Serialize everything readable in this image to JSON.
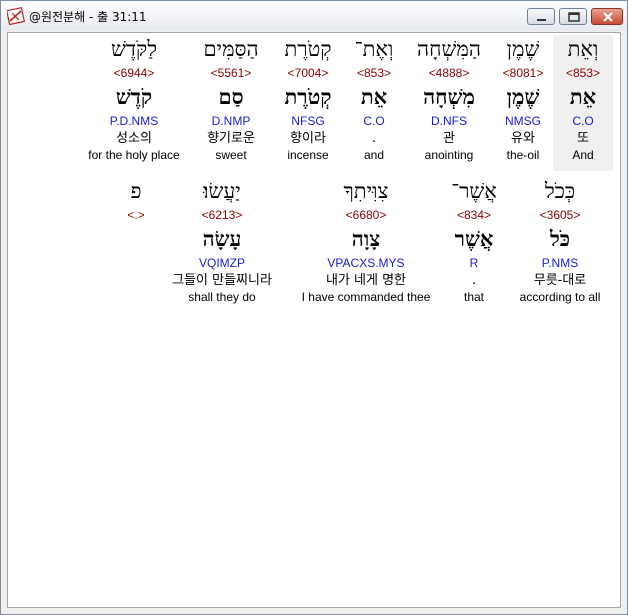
{
  "window": {
    "title": "@원전분해 - 출 31:11"
  },
  "rows": [
    [
      {
        "heb": "וְאֵת",
        "strong": "<853>",
        "lemma": "אֵת",
        "morph": "C.O",
        "korean": "또",
        "english": "And"
      },
      {
        "heb": "שֶׁמֶן",
        "strong": "<8081>",
        "lemma": "שֶׁמֶן",
        "morph": "NMSG",
        "korean": "유와",
        "english": "the-oil"
      },
      {
        "heb": "הַמִּשְׁחָה",
        "strong": "<4888>",
        "lemma": "מִשְׁחָה",
        "morph": "D.NFS",
        "korean": "관",
        "english": "anointing"
      },
      {
        "heb": "וְאֶת־",
        "strong": "<853>",
        "lemma": "אֵת",
        "morph": "C.O",
        "korean": ".",
        "english": "and"
      },
      {
        "heb": "קְטֹרֶת",
        "strong": "<7004>",
        "lemma": "קְטֹרֶת",
        "morph": "NFSG",
        "korean": "향이라",
        "english": "incense"
      },
      {
        "heb": "הַסַּמִּים",
        "strong": "<5561>",
        "lemma": "סַם",
        "morph": "D.NMP",
        "korean": "향기로운",
        "english": "sweet"
      },
      {
        "heb": "לַקֹּדֶשׁ",
        "strong": "<6944>",
        "lemma": "קֹדֶשׁ",
        "morph": "P.D.NMS",
        "korean": "성소의",
        "english": "for the holy place"
      }
    ],
    [
      {
        "heb": "כְּכֹל",
        "strong": "<3605>",
        "lemma": "כֹּל",
        "morph": "P.NMS",
        "korean": "무릇-대로",
        "english": "according to all"
      },
      {
        "heb": "אֲשֶׁר־",
        "strong": "<834>",
        "lemma": "אֲשֶׁר",
        "morph": "R",
        "korean": ".",
        "english": "that"
      },
      {
        "heb": "צִוִּיתִךָ",
        "strong": "<6680>",
        "lemma": "צָוָה",
        "morph": "VPACXS.MYS",
        "korean": "내가 네게 명한",
        "english": "I have commanded thee"
      },
      {
        "heb": "יַעֲשׂוּ׃",
        "strong": "<6213>",
        "lemma": "עָשָׂה",
        "morph": "VQIMZP",
        "korean": "그들이 만들찌니라",
        "english": "shall they do"
      },
      {
        "heb": "פ",
        "strong": "<.>",
        "lemma": "",
        "morph": "",
        "korean": "",
        "english": ""
      }
    ]
  ]
}
